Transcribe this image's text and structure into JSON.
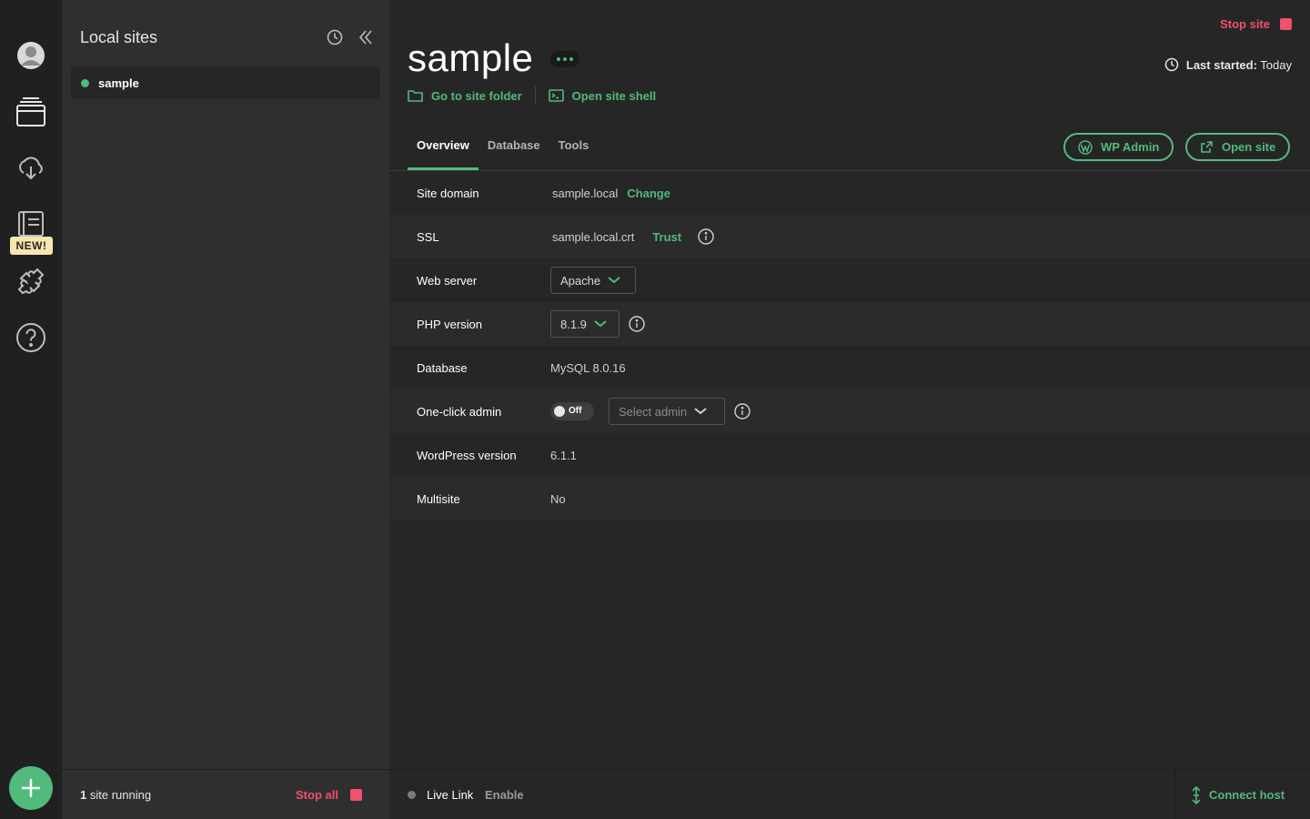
{
  "colors": {
    "accent": "#51bb7b",
    "danger": "#f0516c",
    "badge": "#f6e6b0"
  },
  "rail": {
    "items": [
      {
        "name": "avatar",
        "icon": "user-avatar-icon"
      },
      {
        "name": "local-sites",
        "icon": "sites-icon"
      },
      {
        "name": "cloud",
        "icon": "cloud-download-icon"
      },
      {
        "name": "blueprints",
        "icon": "blueprint-icon"
      },
      {
        "name": "addons",
        "icon": "puzzle-icon"
      },
      {
        "name": "help",
        "icon": "help-icon"
      }
    ],
    "new_badge": "NEW!",
    "add_icon": "plus-icon"
  },
  "sites_panel": {
    "title": "Local sites",
    "icons": [
      "clock-icon",
      "collapse-icon"
    ],
    "sites": [
      {
        "name": "sample",
        "status": "running"
      }
    ],
    "footer": {
      "count": "1",
      "running_label": " site running",
      "stop_all": "Stop all"
    }
  },
  "main": {
    "stop_site": "Stop site",
    "last_started_label": "Last started:",
    "last_started_value": "Today",
    "site_title": "sample",
    "go_to_folder": "Go to site folder",
    "open_shell": "Open site shell",
    "tabs": [
      "Overview",
      "Database",
      "Tools"
    ],
    "active_tab": "Overview",
    "wp_admin": "WP Admin",
    "open_site": "Open site",
    "rows": {
      "site_domain": {
        "label": "Site domain",
        "value": "sample.local",
        "action": "Change"
      },
      "ssl": {
        "label": "SSL",
        "value": "sample.local.crt",
        "action": "Trust"
      },
      "web_server": {
        "label": "Web server",
        "value": "Apache"
      },
      "php": {
        "label": "PHP version",
        "value": "8.1.9"
      },
      "database": {
        "label": "Database",
        "value": "MySQL 8.0.16"
      },
      "one_click": {
        "label": "One-click admin",
        "toggle": "Off",
        "placeholder": "Select admin"
      },
      "wp_version": {
        "label": "WordPress version",
        "value": "6.1.1"
      },
      "multisite": {
        "label": "Multisite",
        "value": "No"
      }
    },
    "footer": {
      "live_link": "Live Link",
      "enable": "Enable",
      "connect_host": "Connect host"
    }
  }
}
